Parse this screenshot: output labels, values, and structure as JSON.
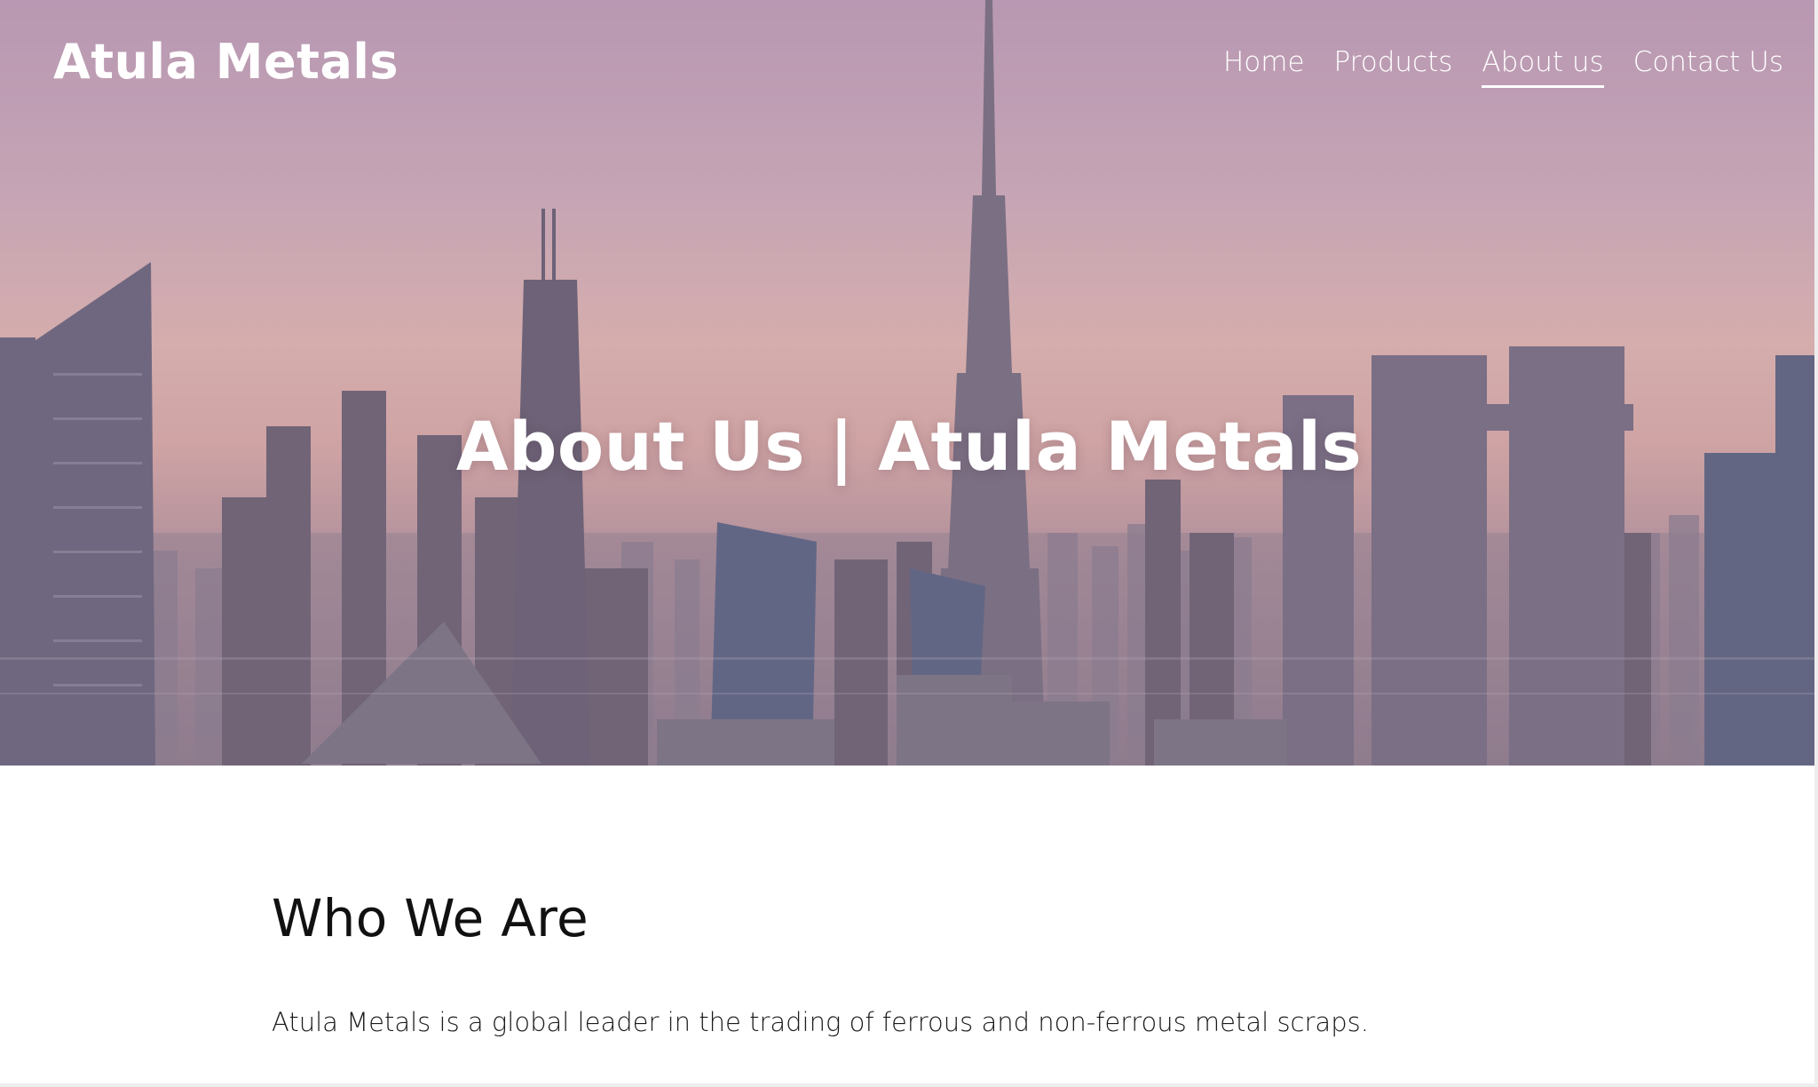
{
  "header": {
    "site_title": "Atula Metals",
    "nav": [
      {
        "label": "Home"
      },
      {
        "label": "Products"
      },
      {
        "label": "About us"
      },
      {
        "label": "Contact Us"
      }
    ]
  },
  "hero": {
    "heading": "About Us | Atula Metals"
  },
  "main": {
    "section_title": "Who We Are",
    "section_text": "Atula Metals is a global leader in the trading of ferrous and non-ferrous metal scraps."
  }
}
